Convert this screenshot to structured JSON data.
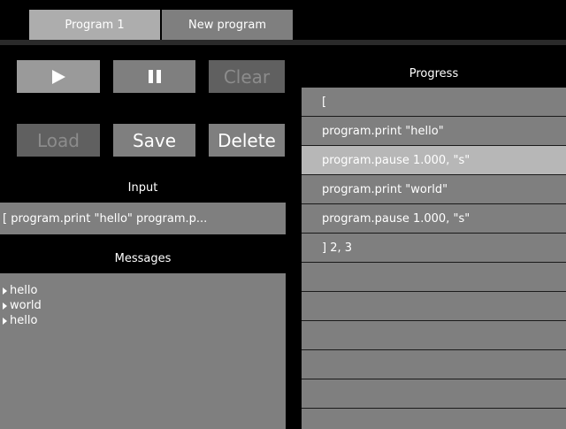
{
  "tabs": [
    {
      "label": "Program 1",
      "active": true
    },
    {
      "label": "New program",
      "active": false
    }
  ],
  "controls": {
    "play_icon": "play-icon",
    "pause_icon": "pause-icon",
    "clear_label": "Clear",
    "load_label": "Load",
    "save_label": "Save",
    "delete_label": "Delete"
  },
  "input": {
    "heading": "Input",
    "value": "[ program.print \"hello\" program.p..."
  },
  "messages": {
    "heading": "Messages",
    "items": [
      "hello",
      "world",
      "hello"
    ]
  },
  "progress": {
    "heading": "Progress",
    "rows": [
      "[",
      "program.print \"hello\"",
      "program.pause 1.000, \"s\"",
      "program.print \"world\"",
      "program.pause 1.000, \"s\"",
      "] 2, 3",
      "",
      "",
      "",
      "",
      "",
      ""
    ],
    "highlighted_row": 2
  },
  "colors": {
    "background": "#000000",
    "panel": "#7f7f7f",
    "highlight": "#b7b7b7",
    "disabled_text": "#8c8c8c"
  }
}
